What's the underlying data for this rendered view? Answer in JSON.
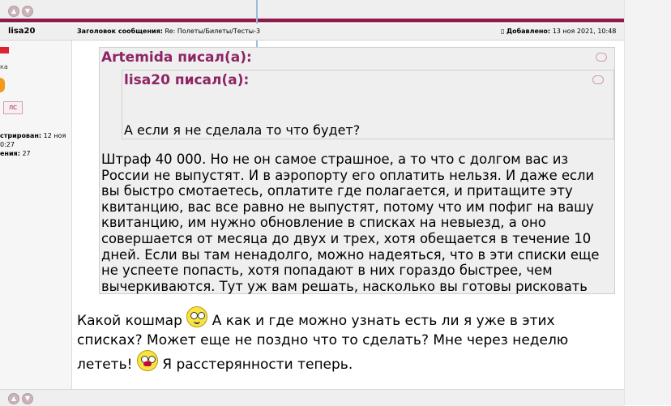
{
  "post": {
    "author": "lisa20",
    "subject_label": "Заголовок сообщения:",
    "subject_value": "Re: Полеты/Билеты/Тесты-3",
    "added_label": "Добавлено:",
    "added_value": "13 ноя 2021, 10:48"
  },
  "sidebar": {
    "rank_frag": "ка",
    "pm_label": "ЛС",
    "registered_label": "стрирован:",
    "registered_value": "12 ноя",
    "registered_time": "0:27",
    "messages_label": "ения:",
    "messages_value": "27"
  },
  "quote_outer": {
    "header": "Artemida писал(а):",
    "text": "Штраф 40 000. Но не он самое страшное, а то что с долгом вас из России не выпустят. И в аэропорту его оплатить нельзя. И даже если вы быстро смотаетесь, оплатите где полагается, и притащите эту квитанцию, вас все равно не выпустят, потому что им пофиг на вашу квитанцию, им нужно обновление в списках на невыезд, а оно совершается от месяца до двух и трех, хотя обещается в течение 10 дней. Если вы там ненадолго, можно надеяться, что в эти списки еще не успеете попасть, хотя попадают в них гораздо быстрее, чем вычеркиваются. Тут уж вам решать, насколько вы готовы рисковать"
  },
  "quote_inner": {
    "header": "lisa20 писал(а):",
    "text": "А если я не сделала то что будет?"
  },
  "reply": {
    "part1": "Какой кошмар",
    "part2": "А как и где можно узнать есть ли я уже в этих списках? Может еще не поздно что то сделать? Мне через неделю лететь!",
    "part3": "Я расстерянности теперь."
  }
}
